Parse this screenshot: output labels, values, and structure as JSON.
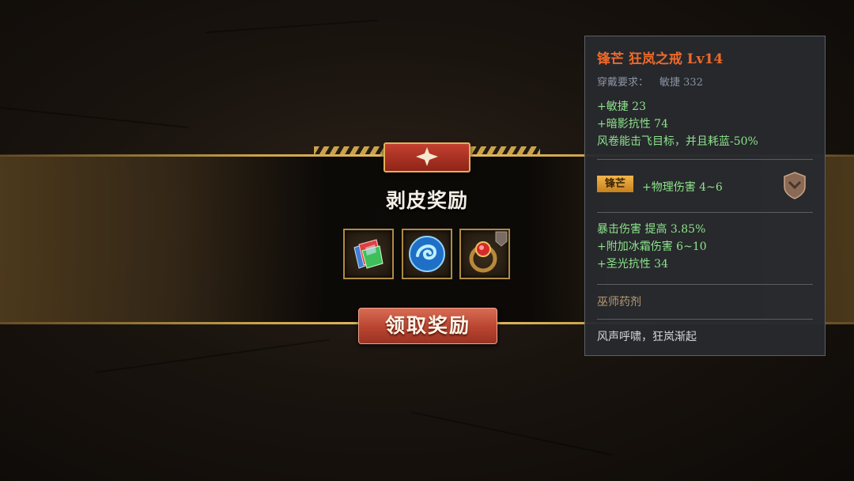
{
  "reward_panel": {
    "title": "剥皮奖励",
    "claim_label": "领取奖励",
    "items": [
      {
        "icon": "crystal-cards-icon"
      },
      {
        "icon": "blue-swirl-orb-icon"
      },
      {
        "icon": "red-gem-ring-icon"
      }
    ]
  },
  "tooltip": {
    "name": "锋芒  狂岚之戒  Lv14",
    "requirement_label": "穿戴要求：",
    "requirement_value": "敏捷 332",
    "base_stats": [
      "+敏捷 23",
      "+暗影抗性 74",
      "风卷能击飞目标，并且耗蓝-50%"
    ],
    "badge": "锋芒",
    "badge_stat": "+物理伤害 4~6",
    "extra_stats": [
      "暴击伤害 提高 3.85%",
      "+附加冰霜伤害 6~10",
      "+圣光抗性 34"
    ],
    "section": "巫师药剂",
    "flavor": "风声呼啸，狂岚渐起"
  },
  "colors": {
    "name": "#ee6a2b",
    "stat": "#8de38c",
    "gold": "#c9a24b",
    "button": "#b8442f"
  }
}
